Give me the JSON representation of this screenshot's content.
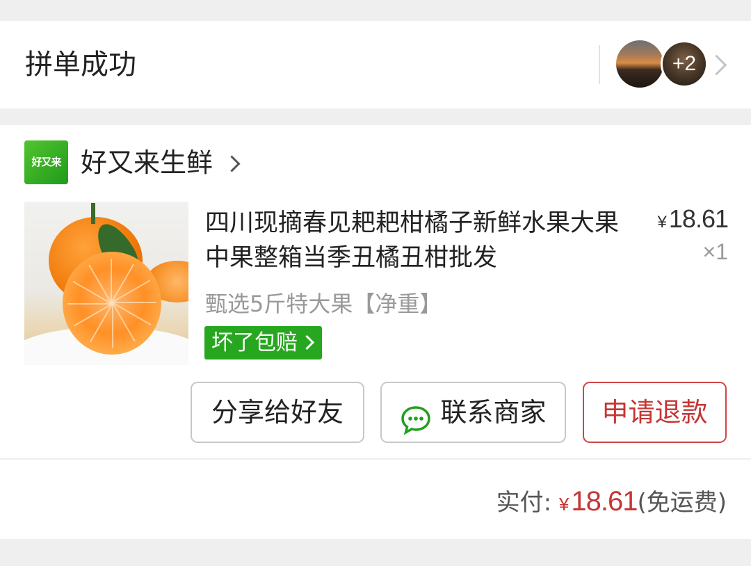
{
  "group": {
    "status": "拼单成功",
    "extra_members": "+2"
  },
  "shop": {
    "logo_text": "好又来",
    "name": "好又来生鲜"
  },
  "product": {
    "title": "四川现摘春见耙耙柑橘子新鲜水果大果中果整箱当季丑橘丑柑批发",
    "price_symbol": "¥",
    "price": "18.61",
    "quantity": "×1",
    "spec": "甄选5斤特大果【净重】",
    "badge": "坏了包赔",
    "image_icon": "orange-product-image"
  },
  "actions": {
    "share": "分享给好友",
    "contact": "联系商家",
    "refund": "申请退款"
  },
  "payment": {
    "label": "实付:",
    "symbol": "¥",
    "amount": "18.61",
    "note": "(免运费)"
  },
  "colors": {
    "accent_red": "#c53634",
    "badge_green": "#27a71f",
    "chat_green": "#21a01c"
  }
}
